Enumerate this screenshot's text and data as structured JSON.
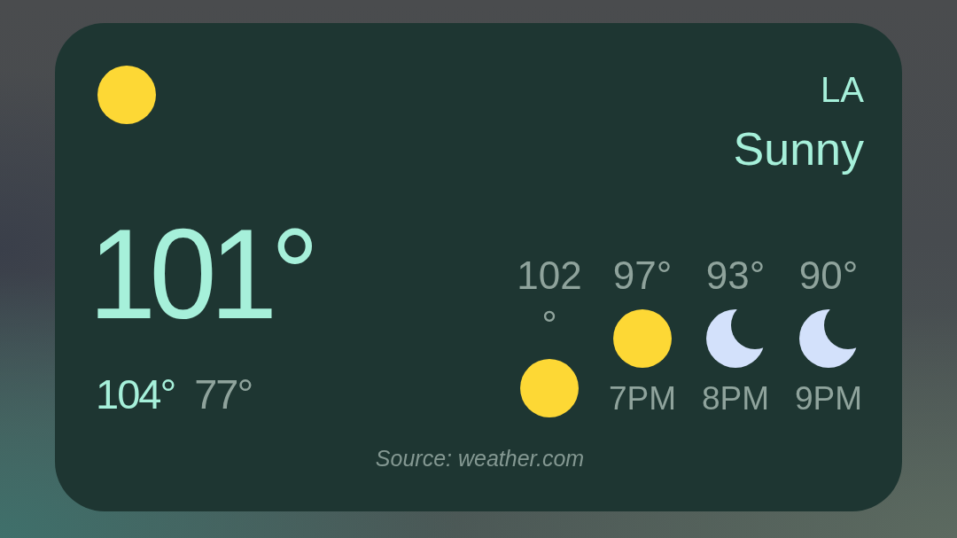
{
  "current": {
    "kind": "sun",
    "temperature": "101°",
    "high": "104°",
    "low": "77°"
  },
  "location": "LA",
  "condition": "Sunny",
  "hourly": [
    {
      "temperature": "102°",
      "kind": "sun"
    },
    {
      "temperature": "97°",
      "kind": "sun",
      "time": "7PM"
    },
    {
      "temperature": "93°",
      "kind": "moon",
      "time": "8PM"
    },
    {
      "temperature": "90°",
      "kind": "moon",
      "time": "9PM"
    }
  ],
  "source": "Source: weather.com"
}
